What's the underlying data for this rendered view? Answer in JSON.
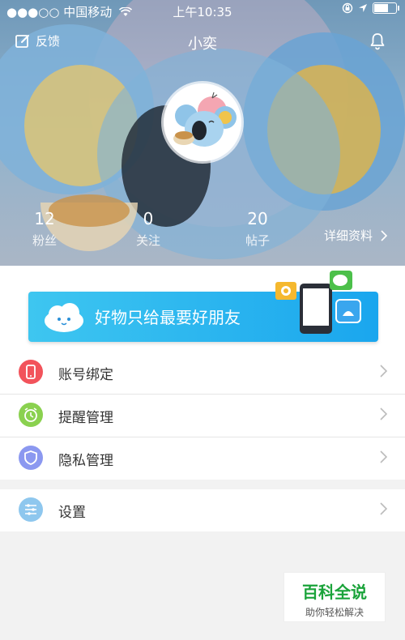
{
  "status_bar": {
    "carrier": "●●●○○ 中国移动",
    "time": "上午10:35"
  },
  "nav": {
    "feedback_label": "反馈",
    "title": "小奕"
  },
  "stats": [
    {
      "value": "12",
      "label": "粉丝"
    },
    {
      "value": "0",
      "label": "关注"
    },
    {
      "value": "20",
      "label": "帖子"
    }
  ],
  "detail_link": "详细资料",
  "banner": {
    "text": "好物只给最要好朋友"
  },
  "menu": [
    {
      "label": "账号绑定",
      "icon": "phone-icon",
      "color": "#f2535b"
    },
    {
      "label": "提醒管理",
      "icon": "alarm-clock-icon",
      "color": "#8ad14f"
    },
    {
      "label": "隐私管理",
      "icon": "shield-icon",
      "color": "#8b98f0"
    }
  ],
  "settings": {
    "label": "设置",
    "icon": "sliders-icon",
    "color": "#8ec7ee"
  },
  "watermark": {
    "title": "百科全说",
    "subtitle": "助你轻松解决"
  }
}
